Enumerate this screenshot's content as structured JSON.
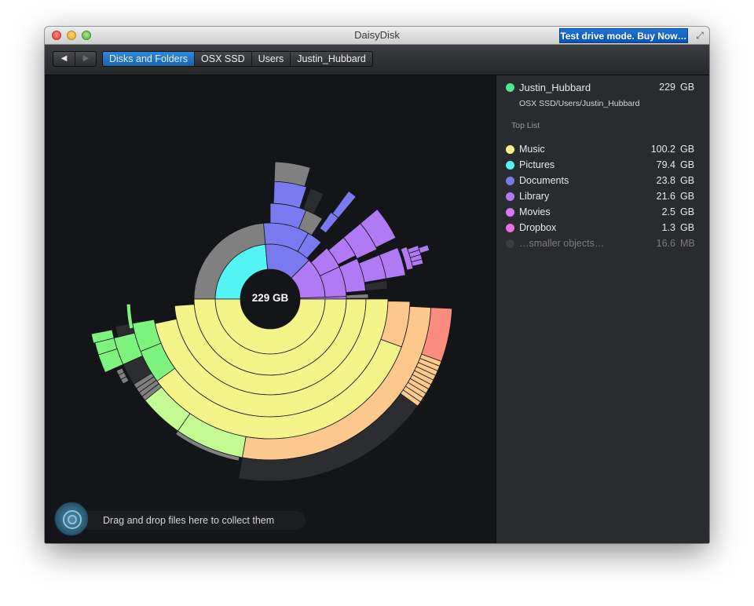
{
  "window": {
    "title": "DaisyDisk",
    "buy_button": "Test drive mode. Buy Now…"
  },
  "toolbar": {
    "back_icon": "◀",
    "forward_icon": "▶",
    "breadcrumbs": [
      "Disks and Folders",
      "OSX SSD",
      "Users",
      "Justin_Hubbard"
    ]
  },
  "chart": {
    "center_label": "229 GB"
  },
  "collector": {
    "text": "Drag and drop files here to collect them"
  },
  "sidebar": {
    "folder": {
      "name": "Justin_Hubbard",
      "size": "229",
      "unit": "GB",
      "color": "#4de89a"
    },
    "path": "OSX SSD/Users/Justin_Hubbard",
    "top_list_title": "Top List",
    "items": [
      {
        "name": "Music",
        "size": "100.2",
        "unit": "GB",
        "color": "#f4f48a"
      },
      {
        "name": "Pictures",
        "size": "79.4",
        "unit": "GB",
        "color": "#54f4f4"
      },
      {
        "name": "Documents",
        "size": "23.8",
        "unit": "GB",
        "color": "#7a7af0"
      },
      {
        "name": "Library",
        "size": "21.6",
        "unit": "GB",
        "color": "#b07af4"
      },
      {
        "name": "Movies",
        "size": "2.5",
        "unit": "GB",
        "color": "#d37af4"
      },
      {
        "name": "Dropbox",
        "size": "1.3",
        "unit": "GB",
        "color": "#ee6ee6"
      },
      {
        "name": "…smaller objects…",
        "size": "16.6",
        "unit": "MB",
        "color": "#3c3d40"
      }
    ]
  },
  "colors": {
    "music": "#f4f48a",
    "music_outer": "#fcc88c",
    "music_red": "#fb8c80",
    "pictures": "#54f4f4",
    "pictures_parent": "#808080",
    "documents": "#7a7af0",
    "library": "#b07af4",
    "green": "#7ef27e",
    "green_light": "#c4fa92",
    "dark_gray": "#2c2d30",
    "gray": "#808080"
  }
}
